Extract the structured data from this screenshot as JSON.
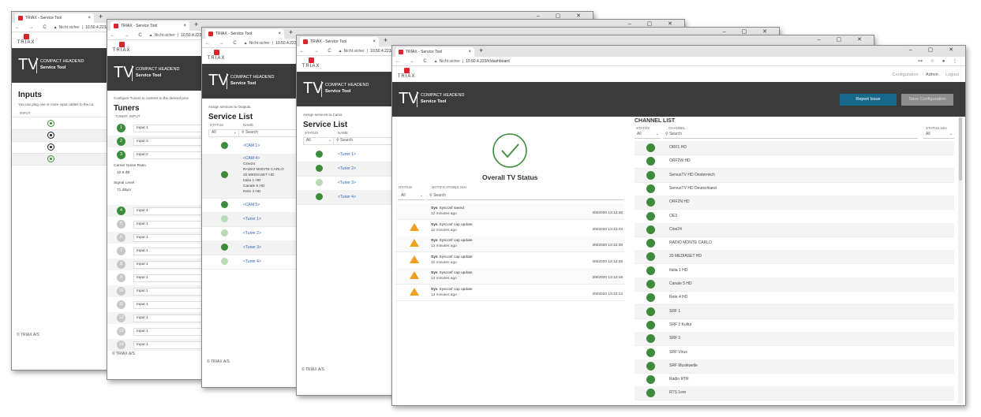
{
  "browser": {
    "tab_title": "TRIAX - Service Tool",
    "tab_close": "×",
    "new_tab": "+",
    "window_controls": "– ▢ ✕",
    "nav_buttons": "← → C",
    "warning": "▲",
    "url_prefix": "Nicht sicher",
    "url_sep": "|",
    "url_short": "10.50.4.223/#",
    "url_full": "10.50.4.223/#/dashboard",
    "right_icons": "⊶ ☆ ●",
    "right_more": "⋮"
  },
  "brand": {
    "logo_text": "TRIAX",
    "tv": "TV",
    "line1": "COMPACT HEADEND",
    "line2": "Service Tool",
    "footer": "© TRIAX A/S",
    "nav_configuration": "Configuration",
    "nav_admin": "Admin",
    "nav_logout": "Logout",
    "icon_names": [
      "triax-logo-icon",
      "warning-icon",
      "star-icon",
      "account-icon",
      "check-circle-icon",
      "warning-triangle-icon",
      "status-dot-icon",
      "radio-selected-icon"
    ]
  },
  "inputs": {
    "title": "Inputs",
    "desc": "You can plug one or more input cables to the ca",
    "col_input": "INPUT"
  },
  "tuners": {
    "desc": "Configure Tuners to connect to the desired prov",
    "title": "Tuners",
    "col_tuner": "TUNER",
    "col_input": "INPUT",
    "carrier_label": "Carrier Noise Ratio",
    "carrier_value": "12.6 dB",
    "signal_label": "Signal Level",
    "signal_value": "71 dBµV",
    "rows": [
      {
        "n": "1",
        "v": "Input 1"
      },
      {
        "n": "2",
        "v": "Input 3"
      },
      {
        "n": "3",
        "v": "Input 2"
      },
      {
        "n": "4",
        "v": "Input 4"
      },
      {
        "n": "5",
        "v": "Input 1"
      },
      {
        "n": "6",
        "v": "Input 1"
      },
      {
        "n": "7",
        "v": "Input 1"
      },
      {
        "n": "8",
        "v": "Input 1"
      },
      {
        "n": "9",
        "v": "Input 1"
      },
      {
        "n": "10",
        "v": "Input 1"
      },
      {
        "n": "11",
        "v": "Input 1"
      },
      {
        "n": "12",
        "v": "Input 1"
      },
      {
        "n": "13",
        "v": "Input 1"
      },
      {
        "n": "14",
        "v": "Input 1"
      }
    ]
  },
  "outputs": {
    "desc": "Assign services to Outputs.",
    "title": "Service List",
    "col_status": "STATUS",
    "col_name": "NAME",
    "filter": "All",
    "search": "Search",
    "cam1": "<CAM 1>",
    "cam4": "<CAM 4>",
    "cam4_lines": [
      "Cine24",
      "RADIO MONTE CARLO",
      "20 MEDIASET HD",
      "Italia 1 HD",
      "Canale 5 HD",
      "Rete 4 HD"
    ],
    "cam5": "<CAM 5>",
    "tuner1": "<Tuner 1>",
    "tuner2": "<Tuner 2>",
    "tuner3": "<Tuner 3>",
    "tuner4": "<Tuner 4>"
  },
  "cams": {
    "desc": "Assign services to Cams.",
    "title": "Service List",
    "col_status": "STATUS",
    "col_name": "NAME",
    "filter": "All",
    "search": "Search",
    "items": [
      "<Tuner 1>",
      "<Tuner 2>",
      "<Tuner 3>",
      "<Tuner 4>"
    ]
  },
  "dashboard": {
    "report_issue": "Report Issue",
    "save_configuration": "Save Configuration",
    "overall": "Overall TV Status",
    "notif_col_status": "STATUS",
    "notif_col_title": "NOTIFICATIONS 24H",
    "filter": "All",
    "search": "Search",
    "notifications": [
      {
        "bold": "Sys",
        "text": "Sysconf saved",
        "ago": "12 minutes ago",
        "time": "3/8/2020 13:12:46",
        "warn": false
      },
      {
        "bold": "Sys",
        "text": "Sysconf cap update",
        "ago": "12 minutes ago",
        "time": "3/8/2020 13:12:43",
        "warn": true
      },
      {
        "bold": "Sys",
        "text": "Sysconf cap update",
        "ago": "12 minutes ago",
        "time": "3/8/2020 13:12:38",
        "warn": true
      },
      {
        "bold": "Sys",
        "text": "Sysconf cap update",
        "ago": "12 minutes ago",
        "time": "3/8/2020 13:12:28",
        "warn": true
      },
      {
        "bold": "Sys",
        "text": "Sysconf cap update",
        "ago": "13 minutes ago",
        "time": "3/8/2020 13:12:18",
        "warn": true
      },
      {
        "bold": "Sys",
        "text": "Sysconf cap update",
        "ago": "13 minutes ago",
        "time": "3/8/2020 13:12:14",
        "warn": true
      }
    ],
    "channel_title": "CHANNEL LIST",
    "ch_col_status": "STATUS",
    "ch_col_channel": "CHANNEL",
    "ch_col_status24": "STATUS 24H",
    "channels": [
      "ORF1 HD",
      "ORF2W HD",
      "ServusTV HD Oesterreich",
      "ServusTV HD Deutschland",
      "ORF2N HD",
      "OE3",
      "Cine24",
      "RADIO MONTE CARLO",
      "20 MEDIASET HD",
      "Italia 1 HD",
      "Canale 5 HD",
      "Rete 4 HD",
      "SRF 1",
      "SRF 2 Kultur",
      "SRF 3",
      "SRF Virus",
      "SRF Musikwelle",
      "Radio RTR",
      "RTS 1ere"
    ]
  },
  "colors": {
    "green": "#3c8c3c",
    "light_green": "#b7dcb5",
    "header": "#3b3b3b",
    "accent": "#17698c",
    "brand_red": "#d9262c",
    "warning": "#f0a020"
  }
}
